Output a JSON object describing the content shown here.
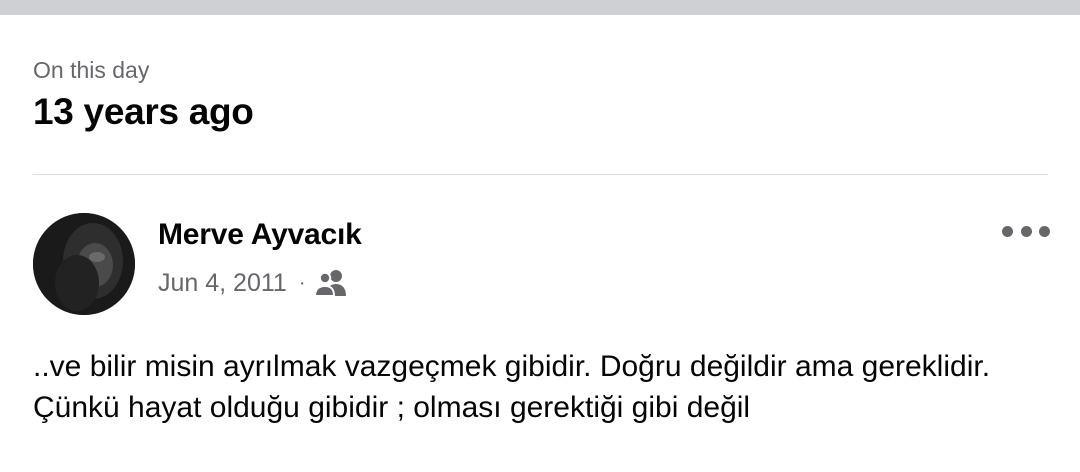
{
  "memory": {
    "subtitle": "On this day",
    "title": "13 years ago"
  },
  "post": {
    "author": "Merve Ayvacık",
    "date": "Jun 4, 2011",
    "separator": "·",
    "audience_icon": "friends-icon",
    "more_icon": "more-options-icon",
    "text": "..ve bilir misin ayrılmak vazgeçmek gibidir. Doğru değildir ama gereklidir. Çünkü hayat olduğu gibidir ; olması gerektiği gibi değil"
  },
  "colors": {
    "top_bar": "#ced0d4",
    "primary_text": "#050505",
    "secondary_text": "#65676b",
    "divider": "#dadde1"
  }
}
